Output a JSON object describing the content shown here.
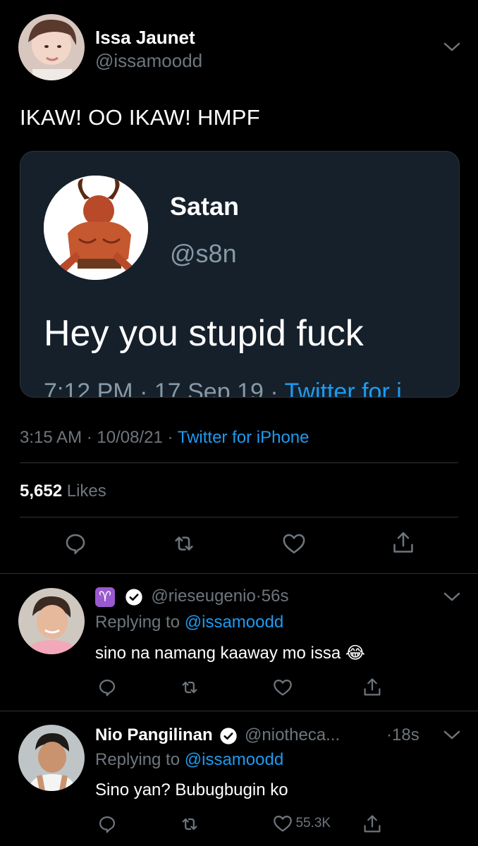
{
  "main_tweet": {
    "display_name": "Issa Jaunet",
    "handle": "@issamoodd",
    "text": "IKAW! OO IKAW! HMPF",
    "time": "3:15 AM",
    "date": "10/08/21",
    "source": "Twitter for iPhone",
    "likes_count": "5,652",
    "likes_label": "Likes"
  },
  "quoted_tweet": {
    "display_name": "Satan",
    "handle": "@s8n",
    "text": "Hey you stupid fuck",
    "time": "7:12 PM",
    "date": "17 Sep 19",
    "source": "Twitter for i"
  },
  "replies": [
    {
      "zodiac": "♈",
      "handle": "@rieseugenio",
      "age": "56s",
      "replying_label": "Replying to",
      "replying_to": "@issamoodd",
      "text": "sino na namang kaaway mo issa",
      "emoji": "😂"
    },
    {
      "display_name": "Nio Pangilinan",
      "handle": "@niotheca...",
      "age": "18s",
      "replying_label": "Replying to",
      "replying_to": "@issamoodd",
      "text": "Sino yan? Bubugbugin ko",
      "like_count": "55.3K"
    }
  ],
  "separator": "·",
  "colors": {
    "accent": "#1d9bf0",
    "muted": "#6e767d",
    "background": "#000000",
    "quote_bg": "#15202b"
  }
}
